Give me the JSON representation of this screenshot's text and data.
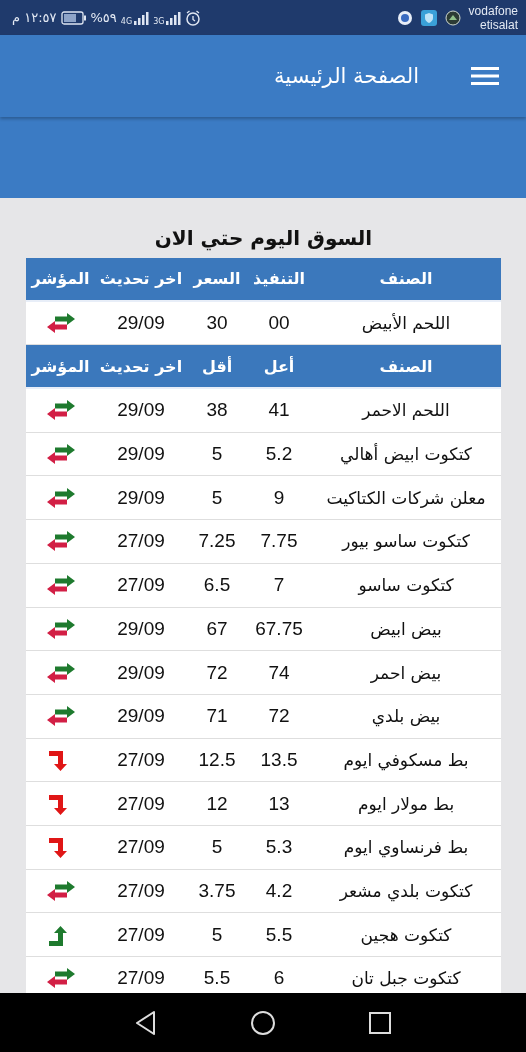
{
  "status_bar": {
    "time": "١٢:٥٧ م",
    "battery": "%٥٩",
    "network_1": "4G",
    "network_2": "3G",
    "carrier_1": "vodafone",
    "carrier_2": "etisalat"
  },
  "app_bar": {
    "title": "الصفحة الرئيسية"
  },
  "heading": "السوق اليوم حتي الان",
  "tables": [
    {
      "columns": [
        "الصنف",
        "التنفيذ",
        "السعر",
        "اخر تحديث",
        "المؤشر"
      ],
      "rows": [
        {
          "cells": [
            "اللحم الأبيض",
            "00",
            "30",
            "29/09"
          ],
          "kind": "flat"
        }
      ]
    },
    {
      "columns": [
        "الصنف",
        "أعل",
        "أقل",
        "اخر تحديث",
        "المؤشر"
      ],
      "rows": [
        {
          "cells": [
            "اللحم الاحمر",
            "41",
            "38",
            "29/09"
          ],
          "kind": "flat"
        },
        {
          "cells": [
            "كتكوت ابيض أهالي",
            "5.2",
            "5",
            "29/09"
          ],
          "kind": "flat"
        },
        {
          "cells": [
            "معلن شركات الكتاكيت",
            "9",
            "5",
            "29/09"
          ],
          "kind": "flat"
        },
        {
          "cells": [
            "كتكوت ساسو بيور",
            "7.75",
            "7.25",
            "27/09"
          ],
          "kind": "flat"
        },
        {
          "cells": [
            "كتكوت ساسو",
            "7",
            "6.5",
            "27/09"
          ],
          "kind": "flat"
        },
        {
          "cells": [
            "بيض ابيض",
            "67.75",
            "67",
            "29/09"
          ],
          "kind": "flat"
        },
        {
          "cells": [
            "بيض احمر",
            "74",
            "72",
            "29/09"
          ],
          "kind": "flat"
        },
        {
          "cells": [
            "بيض بلدي",
            "72",
            "71",
            "29/09"
          ],
          "kind": "flat"
        },
        {
          "cells": [
            "بط مسكوفي ايوم",
            "13.5",
            "12.5",
            "27/09"
          ],
          "kind": "down"
        },
        {
          "cells": [
            "بط مولار ايوم",
            "13",
            "12",
            "27/09"
          ],
          "kind": "down"
        },
        {
          "cells": [
            "بط فرنساوي ايوم",
            "5.3",
            "5",
            "27/09"
          ],
          "kind": "down"
        },
        {
          "cells": [
            "كتكوت بلدي مشعر",
            "4.2",
            "3.75",
            "27/09"
          ],
          "kind": "flat"
        },
        {
          "cells": [
            "كتكوت هجين",
            "5.5",
            "5",
            "27/09"
          ],
          "kind": "up"
        },
        {
          "cells": [
            "كتكوت جبل تان",
            "6",
            "5.5",
            "27/09"
          ],
          "kind": "flat"
        }
      ]
    }
  ]
}
